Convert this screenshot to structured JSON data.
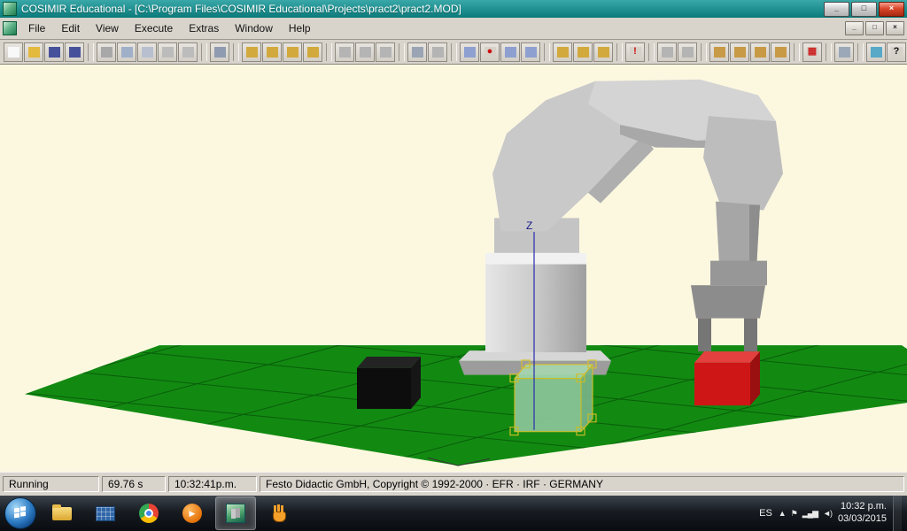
{
  "window": {
    "title": "COSIMIR Educational - [C:\\Program Files\\COSIMIR Educational\\Projects\\pract2\\pract2.MOD]",
    "controls": {
      "minimize": "_",
      "restore": "□",
      "close": "×"
    }
  },
  "menu": {
    "items": [
      "File",
      "Edit",
      "View",
      "Execute",
      "Extras",
      "Window",
      "Help"
    ],
    "mdi_controls": {
      "minimize": "_",
      "restore": "□",
      "close": "×"
    }
  },
  "toolbar": {
    "groups": [
      {
        "icons": [
          {
            "name": "new-file",
            "color": "#f8f8f8"
          },
          {
            "name": "open-file",
            "color": "#e3b93e"
          },
          {
            "name": "save-file",
            "color": "#46519b"
          },
          {
            "name": "save-workcell",
            "color": "#46519b"
          }
        ]
      },
      {
        "icons": [
          {
            "name": "cut",
            "color": "#a8a8a8"
          },
          {
            "name": "copy",
            "color": "#9fb0c8"
          },
          {
            "name": "paste",
            "color": "#b8c0d0"
          },
          {
            "name": "undo",
            "color": "#bcbcbc"
          },
          {
            "name": "redo",
            "color": "#bcbcbc"
          }
        ]
      },
      {
        "icons": [
          {
            "name": "print",
            "color": "#8f9bb0"
          }
        ]
      },
      {
        "icons": [
          {
            "name": "robot-position",
            "color": "#d2a93c"
          },
          {
            "name": "robot-tool",
            "color": "#d2a93c"
          },
          {
            "name": "robot-joint",
            "color": "#d2a93c"
          },
          {
            "name": "robot-workcell",
            "color": "#d2a93c"
          }
        ]
      },
      {
        "icons": [
          {
            "name": "chart-view",
            "color": "#b4b4b4"
          },
          {
            "name": "oscilloscope",
            "color": "#b4b4b4"
          },
          {
            "name": "diagram",
            "color": "#b4b4b4"
          }
        ]
      },
      {
        "icons": [
          {
            "name": "render-view",
            "color": "#9aa4b4"
          },
          {
            "name": "camera-view",
            "color": "#b4b4b4"
          }
        ]
      },
      {
        "icons": [
          {
            "name": "message-list",
            "color": "#8ea0d0"
          },
          {
            "name": "stop-execution",
            "color": "#d6d2ca",
            "glyph": "●",
            "fg": "#cc1111"
          },
          {
            "name": "watch-list",
            "color": "#8ea0d0"
          },
          {
            "name": "variable-list",
            "color": "#8ea0d0"
          }
        ]
      },
      {
        "icons": [
          {
            "name": "project-open",
            "color": "#d2a93c"
          },
          {
            "name": "project-compile",
            "color": "#d2a93c"
          },
          {
            "name": "project-download",
            "color": "#d2a93c"
          }
        ]
      },
      {
        "icons": [
          {
            "name": "compile-stop",
            "color": "#d6d2ca",
            "glyph": "!",
            "fg": "#cc1111"
          }
        ]
      },
      {
        "icons": [
          {
            "name": "pointer-tool",
            "color": "#b4b4b4"
          },
          {
            "name": "measure-tool",
            "color": "#b4b4b4"
          }
        ]
      },
      {
        "icons": [
          {
            "name": "grab-object",
            "color": "#c89a46"
          },
          {
            "name": "move-object",
            "color": "#c89a46"
          },
          {
            "name": "rotate-object",
            "color": "#c89a46"
          },
          {
            "name": "place-object",
            "color": "#c89a46"
          }
        ]
      },
      {
        "icons": [
          {
            "name": "io-monitor",
            "color": "#d6d2ca",
            "glyph": "▦",
            "fg": "#cc2222"
          }
        ]
      },
      {
        "icons": [
          {
            "name": "window-layout",
            "color": "#9aa8b8"
          }
        ]
      },
      {
        "icons": [
          {
            "name": "model-explorer",
            "color": "#58a8c8"
          },
          {
            "name": "context-help",
            "color": "#d6d2ca",
            "glyph": "?",
            "fg": "#101010"
          }
        ]
      }
    ]
  },
  "viewport": {
    "z_axis_label": "Z",
    "floor_color": "#128a12",
    "background_color": "#fcf8e0",
    "selection_color": "#d8c228",
    "workpieces": [
      "black-cube",
      "green-cube-selected",
      "red-cube"
    ]
  },
  "statusbar": {
    "state": "Running",
    "sim_time": "69.76 s",
    "clock": "10:32:41p.m.",
    "copyright": "Festo Didactic GmbH, Copyright © 1992-2000 · EFR · IRF · GERMANY"
  },
  "taskbar": {
    "apps": [
      {
        "name": "explorer"
      },
      {
        "name": "remote"
      },
      {
        "name": "chrome"
      },
      {
        "name": "media",
        "glyph": "▶"
      },
      {
        "name": "cosimir",
        "active": true
      },
      {
        "name": "hand"
      }
    ],
    "tray": {
      "lang": "ES",
      "icons": [
        {
          "name": "hidden-icons",
          "glyph": "▲"
        },
        {
          "name": "action-center",
          "glyph": "⚑"
        },
        {
          "name": "network",
          "glyph": "▂▄▆"
        },
        {
          "name": "volume",
          "glyph": "◄)"
        }
      ],
      "time": "10:32 p.m.",
      "date": "03/03/2015"
    }
  }
}
